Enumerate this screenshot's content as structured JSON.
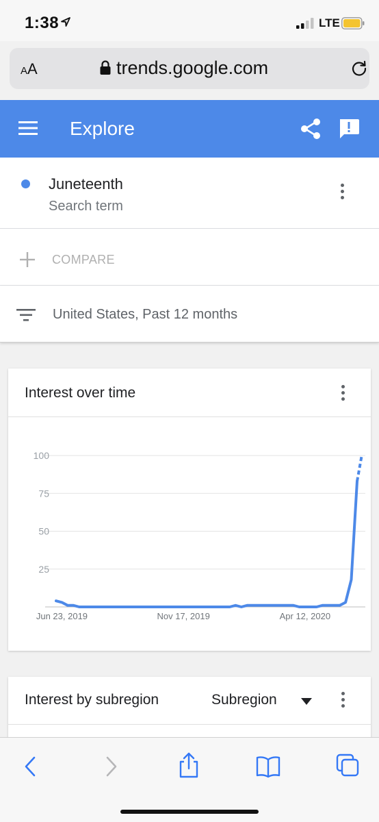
{
  "status_bar": {
    "time": "1:38",
    "network": "LTE",
    "icons": [
      "location-arrow-icon",
      "signal-icon",
      "battery-icon"
    ]
  },
  "browser": {
    "text_size": "AA",
    "url": "trends.google.com",
    "icons": [
      "lock-icon",
      "reload-icon"
    ]
  },
  "header": {
    "title": "Explore",
    "icons": [
      "menu-icon",
      "share-icon",
      "feedback-icon"
    ]
  },
  "search_term": {
    "name": "Juneteenth",
    "type": "Search term",
    "color": "#4d89e8"
  },
  "compare": {
    "label": "COMPARE"
  },
  "filter": {
    "label": "United States, Past 12 months"
  },
  "interest_over_time": {
    "title": "Interest over time",
    "y_ticks": [
      "100",
      "75",
      "50",
      "25"
    ],
    "x_ticks": [
      "Jun 23, 2019",
      "Nov 17, 2019",
      "Apr 12, 2020"
    ]
  },
  "chart_data": {
    "type": "line",
    "xlabel": "",
    "ylabel": "",
    "ylim": [
      0,
      100
    ],
    "grid": true,
    "color": "#4d89e8",
    "x": [
      "2019-06-16",
      "2019-06-23",
      "2019-06-30",
      "2019-07-07",
      "2019-07-14",
      "2019-07-21",
      "2019-07-28",
      "2019-08-04",
      "2019-08-11",
      "2019-08-18",
      "2019-08-25",
      "2019-09-01",
      "2019-09-08",
      "2019-09-15",
      "2019-09-22",
      "2019-09-29",
      "2019-10-06",
      "2019-10-13",
      "2019-10-20",
      "2019-10-27",
      "2019-11-03",
      "2019-11-10",
      "2019-11-17",
      "2019-11-24",
      "2019-12-01",
      "2019-12-08",
      "2019-12-15",
      "2019-12-22",
      "2019-12-29",
      "2020-01-05",
      "2020-01-12",
      "2020-01-19",
      "2020-01-26",
      "2020-02-02",
      "2020-02-09",
      "2020-02-16",
      "2020-02-23",
      "2020-03-01",
      "2020-03-08",
      "2020-03-15",
      "2020-03-22",
      "2020-03-29",
      "2020-04-05",
      "2020-04-12",
      "2020-04-19",
      "2020-04-26",
      "2020-05-03",
      "2020-05-10",
      "2020-05-17",
      "2020-05-24",
      "2020-05-31",
      "2020-06-07",
      "2020-06-14"
    ],
    "series": [
      {
        "values": [
          4,
          3,
          1,
          1,
          0,
          0,
          0,
          0,
          0,
          0,
          0,
          0,
          0,
          0,
          0,
          0,
          0,
          0,
          0,
          0,
          0,
          0,
          0,
          0,
          0,
          0,
          0,
          0,
          0,
          0,
          0,
          1,
          0,
          1,
          1,
          1,
          1,
          1,
          1,
          1,
          1,
          1,
          0,
          0,
          0,
          0,
          1,
          1,
          1,
          1,
          3,
          18,
          83
        ],
        "partial_last": {
          "from": 83,
          "to": 100
        }
      }
    ]
  },
  "subregion": {
    "title": "Interest by subregion",
    "selector": "Subregion"
  },
  "toolbar": {
    "icons": [
      "back-icon",
      "forward-icon",
      "share-sheet-icon",
      "bookmarks-icon",
      "tabs-icon"
    ]
  }
}
